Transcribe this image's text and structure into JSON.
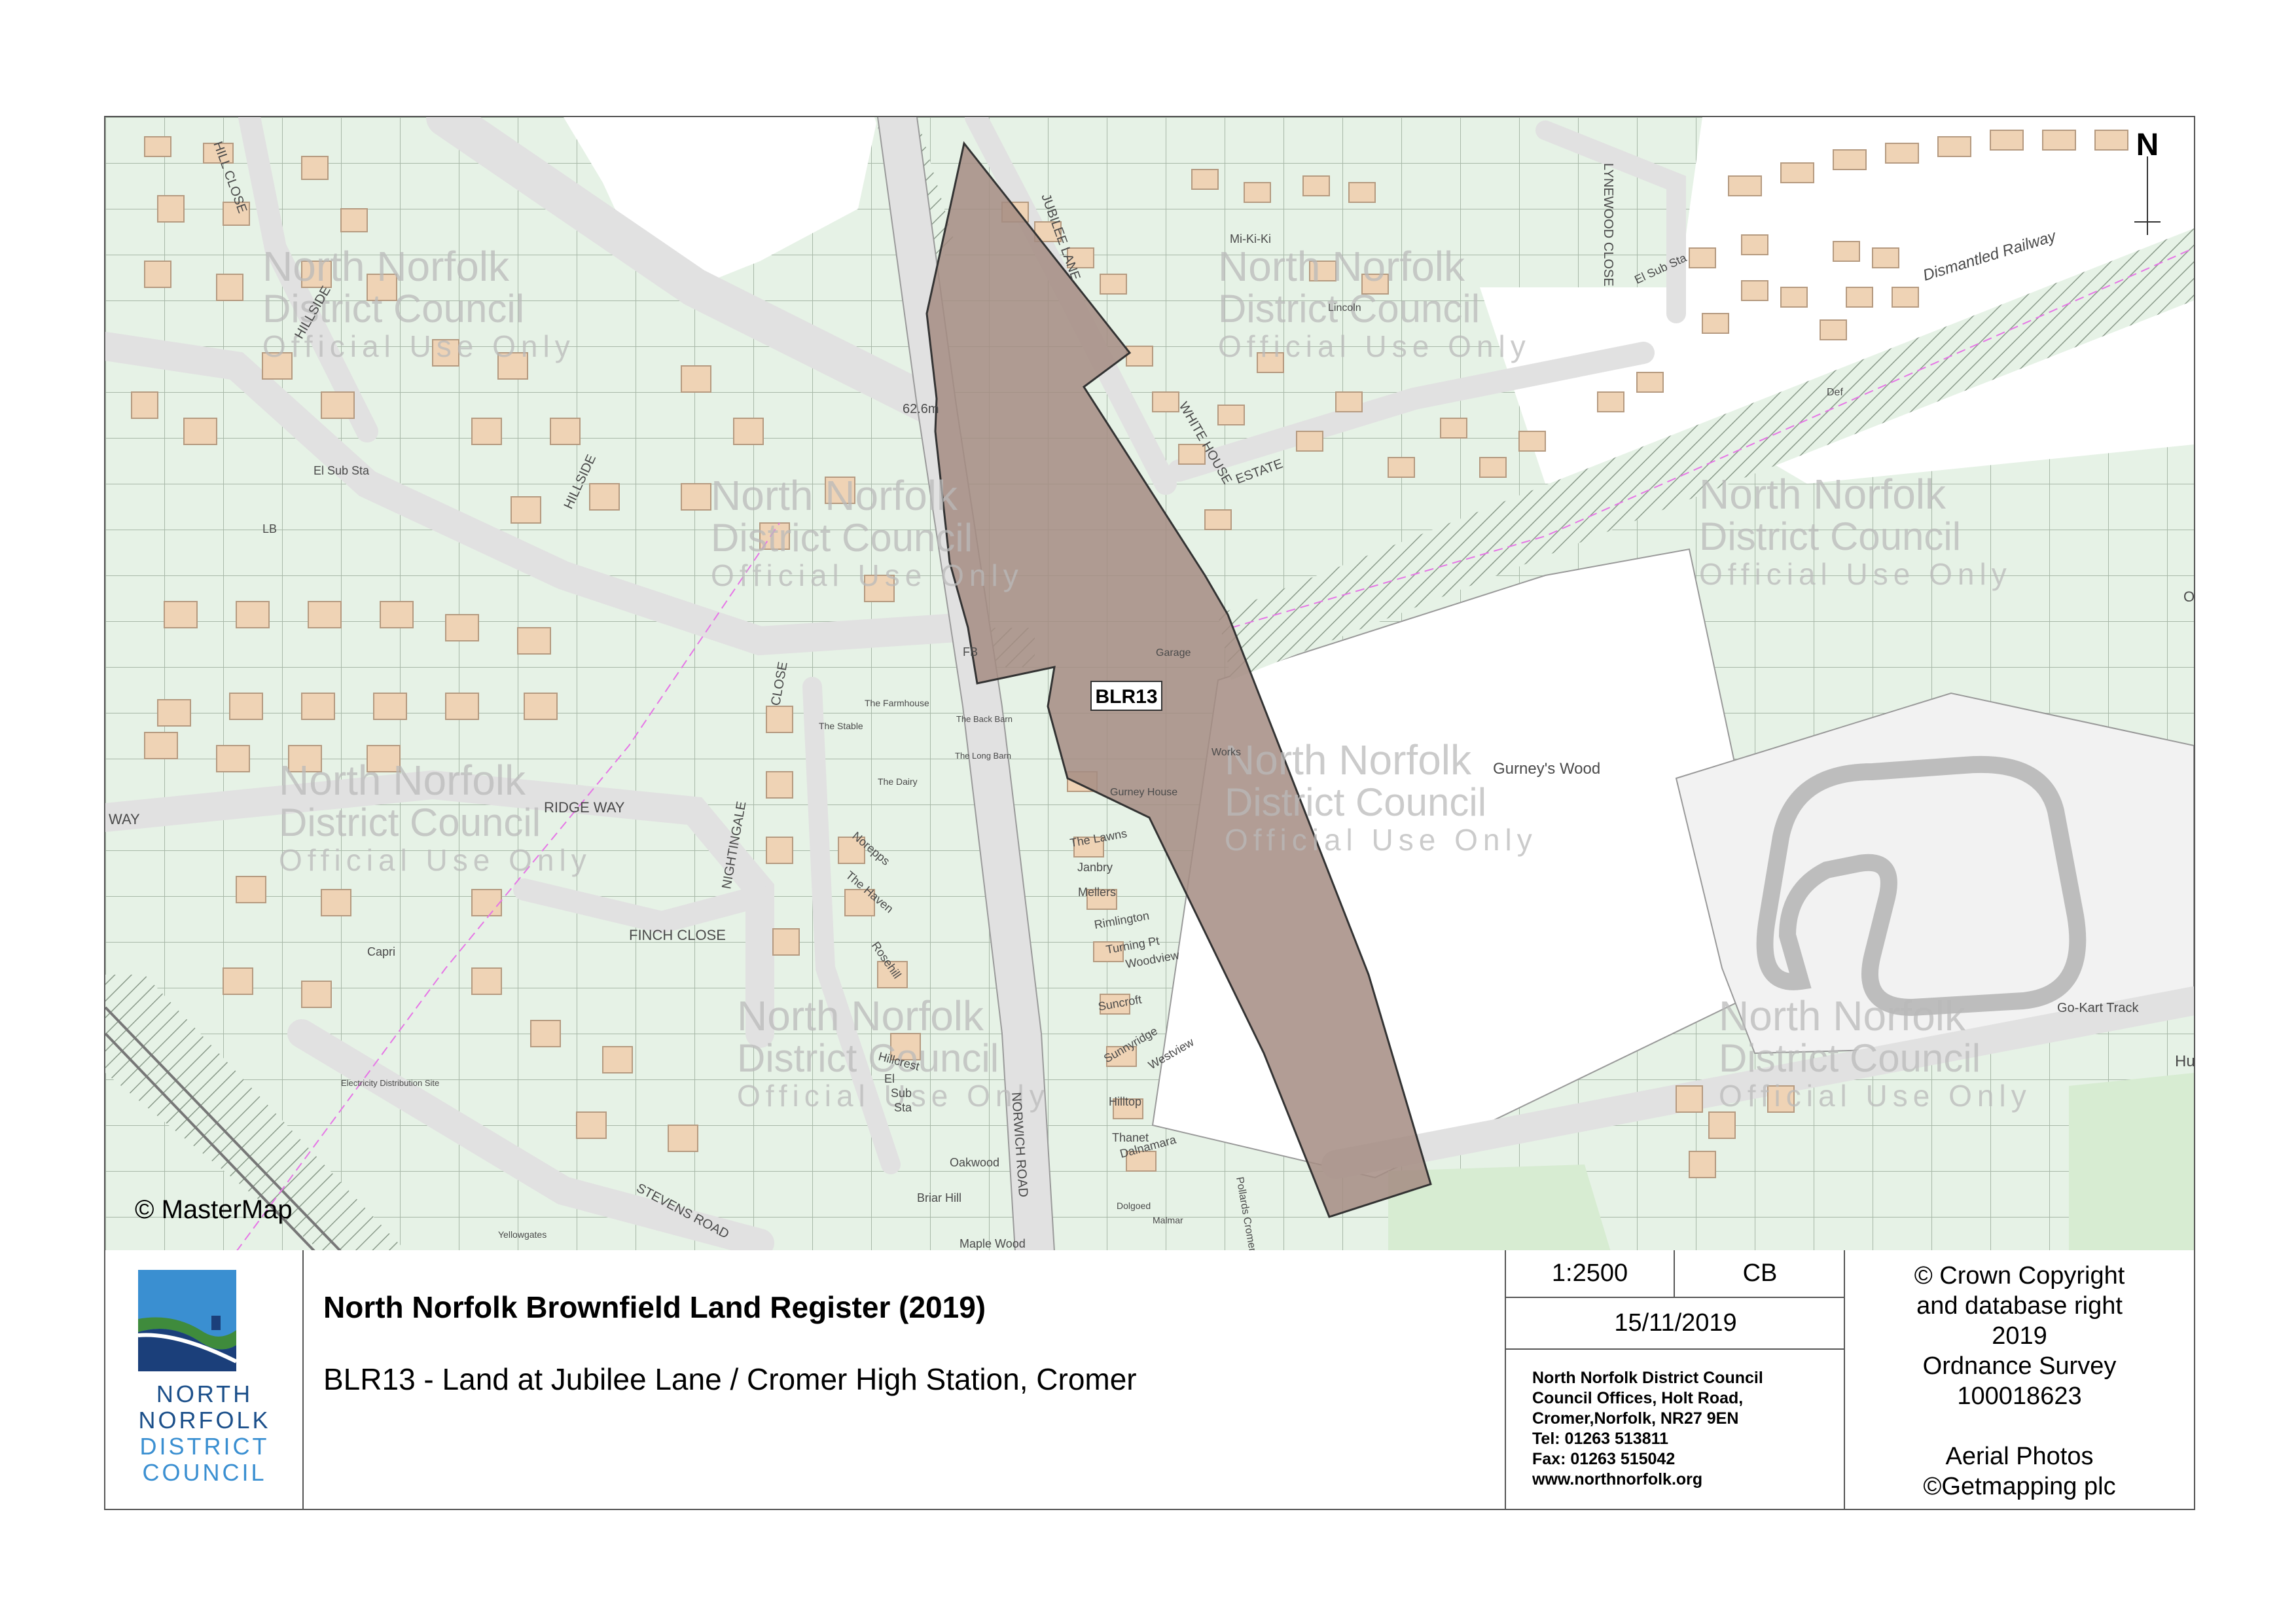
{
  "map": {
    "attribution": "© MasterMap",
    "north_arrow": "N",
    "site_label": "BLR13",
    "watermark": {
      "line1": "North Norfolk",
      "line2": "District Council",
      "line3": "Official Use Only"
    },
    "streets": {
      "hill_close": "HILL CLOSE",
      "hillside": "HILLSIDE",
      "hillside2": "HILLSIDE",
      "jubilee_lane": "JUBILEE LANE",
      "white_house_estate": "WHITE HOUSE",
      "estate": "ESTATE",
      "lynewood_close": "LYNEWOOD CLOSE",
      "ridge_way": "RIDGE WAY",
      "way": "WAY",
      "nightingale_close": "NIGHTINGALE",
      "close": "CLOSE",
      "finch_close": "FINCH CLOSE",
      "norwich_road": "NORWICH ROAD",
      "stevens_road": "STEVENS ROAD"
    },
    "labels": {
      "dismantled_railway": "Dismantled Railway",
      "gurneys_wood": "Gurney's Wood",
      "go_kart_track": "Go-Kart Track",
      "elevation": "62.6m",
      "el_sub_sta_1": "El Sub Sta",
      "el_sub_sta_2": "El Sub Sta",
      "el_sub_sta_3": "El",
      "lb": "LB",
      "sub_sta_3": "Sub",
      "sta_3": "Sta",
      "mi_ki_ki": "Mi-Ki-Ki",
      "lincoln": "Lincoln",
      "the_lawns": "The Lawns",
      "janbry": "Janbry",
      "mellers": "Mellers",
      "rimlington": "Rimlington",
      "turning_point": "Turning Pt",
      "woodview": "Woodview",
      "suncroft": "Suncroft",
      "sunnyridge": "Sunnyridge",
      "westview": "Westview",
      "hilltop": "Hilltop",
      "thanet": "Thanet",
      "dalnamara": "Dalnamara",
      "norepps": "Norepps",
      "the_haven": "The Haven",
      "rosehill": "Rosehill",
      "hillcrest": "Hillcrest",
      "oakwood": "Oakwood",
      "briar_hill": "Briar Hill",
      "maple_wood": "Maple Wood",
      "capri": "Capri",
      "the_stable": "The Stable",
      "the_dairy": "The Dairy",
      "the_farmhouse": "The Farmhouse",
      "back_barn": "The Back Barn",
      "long_barn": "The Long Barn",
      "electricity_site": "Electricity Distribution Site",
      "yellowgates": "Yellowgates",
      "fb": "FB",
      "garage": "Garage",
      "works": "Works",
      "gurney_house": "Gurney House",
      "def": "Def",
      "oa": "Oa",
      "hur": "Hur",
      "dolgoed": "Dolgoed",
      "malmar": "Malmar",
      "pollards_cromer": "Pollards Cromer"
    }
  },
  "title_block": {
    "council_logo_line1": "NORTH",
    "council_logo_line2": "NORFOLK",
    "council_logo_line3": "DISTRICT",
    "council_logo_line4": "COUNCIL",
    "title": "North Norfolk Brownfield Land Register (2019)",
    "subtitle": "BLR13 - Land at Jubilee Lane / Cromer High Station, Cromer",
    "scale": "1:2500",
    "author": "CB",
    "date": "15/11/2019",
    "address": [
      "North Norfolk District Council",
      "Council Offices, Holt Road,",
      "Cromer,Norfolk, NR27 9EN",
      "Tel: 01263 513811",
      "Fax: 01263 515042",
      "www.northnorfolk.org"
    ],
    "copyright": [
      "© Crown Copyright",
      "and database right",
      "2019",
      "Ordnance Survey",
      "100018623",
      "",
      "Aerial Photos",
      "©Getmapping plc"
    ]
  },
  "colors": {
    "parcel_fill": "#e9f4e9",
    "road": "#e6e6e6",
    "building": "#efd3b5",
    "site_fill": "#a48c82",
    "logo_blue": "#1b4f8a",
    "logo_green": "#3f8b3c"
  }
}
